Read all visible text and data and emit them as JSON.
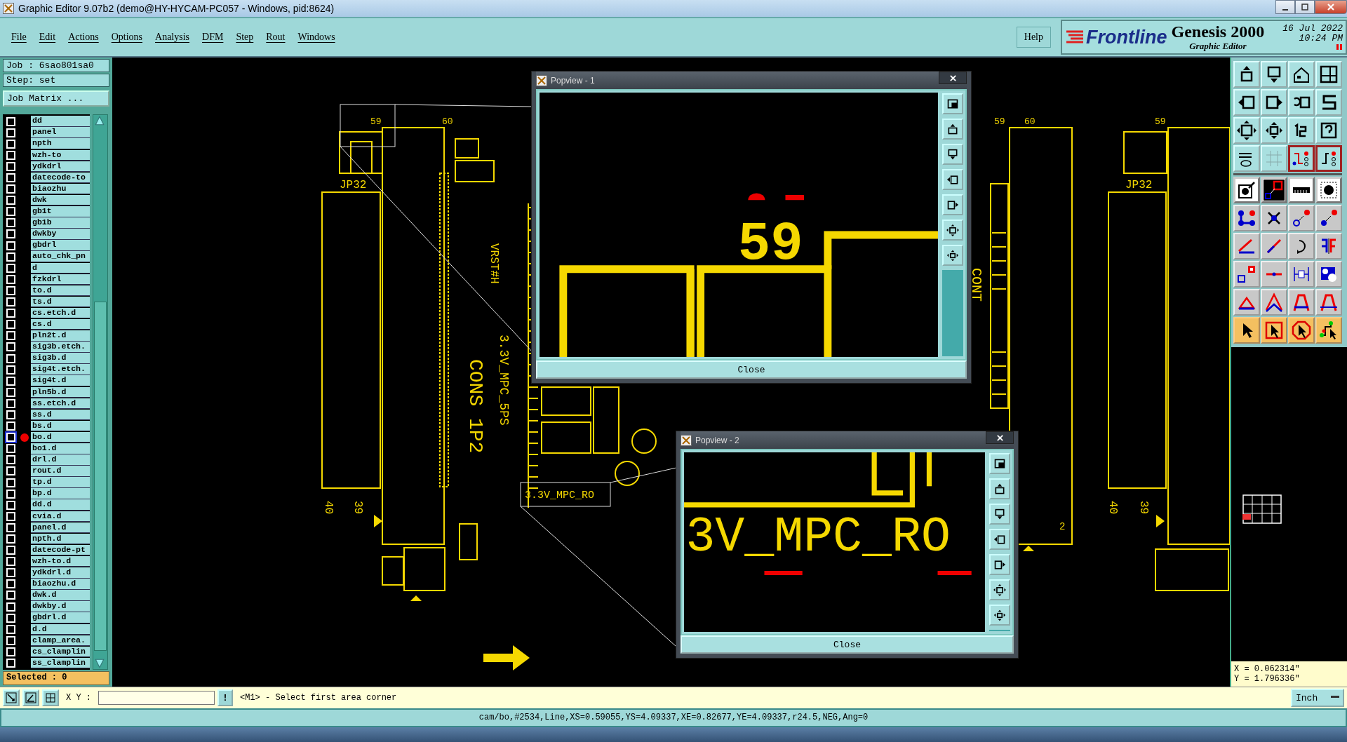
{
  "window": {
    "title": "Graphic Editor 9.07b2 (demo@HY-HYCAM-PC057 - Windows, pid:8624)"
  },
  "menu": [
    {
      "label": "File"
    },
    {
      "label": "Edit"
    },
    {
      "label": "Actions"
    },
    {
      "label": "Options"
    },
    {
      "label": "Analysis"
    },
    {
      "label": "DFM"
    },
    {
      "label": "Step"
    },
    {
      "label": "Rout"
    },
    {
      "label": "Windows"
    }
  ],
  "help": "Help",
  "brand": {
    "logo": "Frontline",
    "product": "Genesis 2000",
    "subtitle": "Graphic Editor",
    "date": "16 Jul 2022",
    "time": "10:24 PM"
  },
  "job": {
    "job": "Job : 6sao801sa0",
    "step": "Step: set",
    "matrix_button": "Job Matrix ..."
  },
  "layers": [
    {
      "name": "dd",
      "checked": false,
      "active": false
    },
    {
      "name": "panel",
      "checked": false,
      "active": false
    },
    {
      "name": "npth",
      "checked": false,
      "active": false
    },
    {
      "name": "wzh-to",
      "checked": false,
      "active": false
    },
    {
      "name": "ydkdrl",
      "checked": false,
      "active": false
    },
    {
      "name": "datecode-to",
      "checked": false,
      "active": false
    },
    {
      "name": "biaozhu",
      "checked": false,
      "active": false
    },
    {
      "name": "dwk",
      "checked": false,
      "active": false
    },
    {
      "name": "gb1t",
      "checked": false,
      "active": false
    },
    {
      "name": "gb1b",
      "checked": false,
      "active": false
    },
    {
      "name": "dwkby",
      "checked": false,
      "active": false
    },
    {
      "name": "gbdrl",
      "checked": false,
      "active": false
    },
    {
      "name": "auto_chk_pn",
      "checked": false,
      "active": false
    },
    {
      "name": "d",
      "checked": false,
      "active": false
    },
    {
      "name": "fzkdrl",
      "checked": false,
      "active": false
    },
    {
      "name": "to.d",
      "checked": false,
      "active": false
    },
    {
      "name": "ts.d",
      "checked": false,
      "active": false
    },
    {
      "name": "cs.etch.d",
      "checked": false,
      "active": false
    },
    {
      "name": "cs.d",
      "checked": false,
      "active": false
    },
    {
      "name": "pln2t.d",
      "checked": false,
      "active": false
    },
    {
      "name": "sig3b.etch.",
      "checked": false,
      "active": false
    },
    {
      "name": "sig3b.d",
      "checked": false,
      "active": false
    },
    {
      "name": "sig4t.etch.",
      "checked": false,
      "active": false
    },
    {
      "name": "sig4t.d",
      "checked": false,
      "active": false
    },
    {
      "name": "pln5b.d",
      "checked": false,
      "active": false
    },
    {
      "name": "ss.etch.d",
      "checked": false,
      "active": false
    },
    {
      "name": "ss.d",
      "checked": false,
      "active": false
    },
    {
      "name": "bs.d",
      "checked": false,
      "active": false
    },
    {
      "name": "bo.d",
      "checked": false,
      "active": true
    },
    {
      "name": "bo1.d",
      "checked": false,
      "active": false
    },
    {
      "name": "drl.d",
      "checked": false,
      "active": false
    },
    {
      "name": "rout.d",
      "checked": false,
      "active": false
    },
    {
      "name": "tp.d",
      "checked": false,
      "active": false
    },
    {
      "name": "bp.d",
      "checked": false,
      "active": false
    },
    {
      "name": "dd.d",
      "checked": false,
      "active": false
    },
    {
      "name": "cvia.d",
      "checked": false,
      "active": false
    },
    {
      "name": "panel.d",
      "checked": false,
      "active": false
    },
    {
      "name": "npth.d",
      "checked": false,
      "active": false
    },
    {
      "name": "datecode-pt",
      "checked": false,
      "active": false
    },
    {
      "name": "wzh-to.d",
      "checked": false,
      "active": false
    },
    {
      "name": "ydkdrl.d",
      "checked": false,
      "active": false
    },
    {
      "name": "biaozhu.d",
      "checked": false,
      "active": false
    },
    {
      "name": "dwk.d",
      "checked": false,
      "active": false
    },
    {
      "name": "dwkby.d",
      "checked": false,
      "active": false
    },
    {
      "name": "gbdrl.d",
      "checked": false,
      "active": false
    },
    {
      "name": "d.d",
      "checked": false,
      "active": false
    },
    {
      "name": "clamp_area.",
      "checked": false,
      "active": false
    },
    {
      "name": "cs_clamplin",
      "checked": false,
      "active": false
    },
    {
      "name": "ss_clamplin",
      "checked": false,
      "active": false
    }
  ],
  "selected_count": "Selected : 0",
  "toolbar": [
    {
      "kind": "teal"
    },
    {
      "kind": "teal"
    },
    {
      "kind": "teal"
    },
    {
      "kind": "teal"
    },
    {
      "kind": "teal"
    },
    {
      "kind": "teal"
    },
    {
      "kind": "teal"
    },
    {
      "kind": "teal"
    },
    {
      "kind": "teal"
    },
    {
      "kind": "teal"
    },
    {
      "kind": "teal"
    },
    {
      "kind": "teal"
    },
    {
      "kind": "teal"
    },
    {
      "kind": "teal"
    },
    {
      "kind": "red"
    },
    {
      "kind": "red"
    },
    {
      "kind": "white"
    },
    {
      "kind": "white"
    },
    {
      "kind": "white"
    },
    {
      "kind": "white"
    },
    {
      "kind": "gray"
    },
    {
      "kind": "gray"
    },
    {
      "kind": "gray"
    },
    {
      "kind": "gray"
    },
    {
      "kind": "gray"
    },
    {
      "kind": "gray"
    },
    {
      "kind": "gray"
    },
    {
      "kind": "gray"
    },
    {
      "kind": "gray"
    },
    {
      "kind": "gray"
    },
    {
      "kind": "gray"
    },
    {
      "kind": "gray"
    },
    {
      "kind": "gray"
    },
    {
      "kind": "gray"
    },
    {
      "kind": "gray"
    },
    {
      "kind": "gray"
    },
    {
      "kind": "orange"
    },
    {
      "kind": "orange"
    },
    {
      "kind": "orange"
    },
    {
      "kind": "orange"
    }
  ],
  "canvas_labels": [
    "59",
    "60",
    "JP32",
    "40",
    "39",
    "CONS 1P2",
    "3.3V_MPC_5PS",
    "VRST#H",
    "3.3V_MPC_RO",
    "59",
    "60",
    "CONT",
    "2",
    "59",
    "JP32",
    "40",
    "39"
  ],
  "popviews": [
    {
      "title": "Popview - 1",
      "close_label": "Close",
      "overlay_label": "59"
    },
    {
      "title": "Popview - 2",
      "close_label": "Close",
      "overlay_label": "3V_MPC_RO"
    }
  ],
  "coordinates": {
    "x": "X = 0.062314\"",
    "y": "Y = 1.796336\""
  },
  "command": {
    "label": "X Y :",
    "bang": "!",
    "prompt": "<M1> - Select first area corner",
    "units": "Inch"
  },
  "status_bar": "cam/bo,#2534,Line,XS=0.59055,YS=4.09337,XE=0.82677,YE=4.09337,r24.5,NEG,Ang=0"
}
